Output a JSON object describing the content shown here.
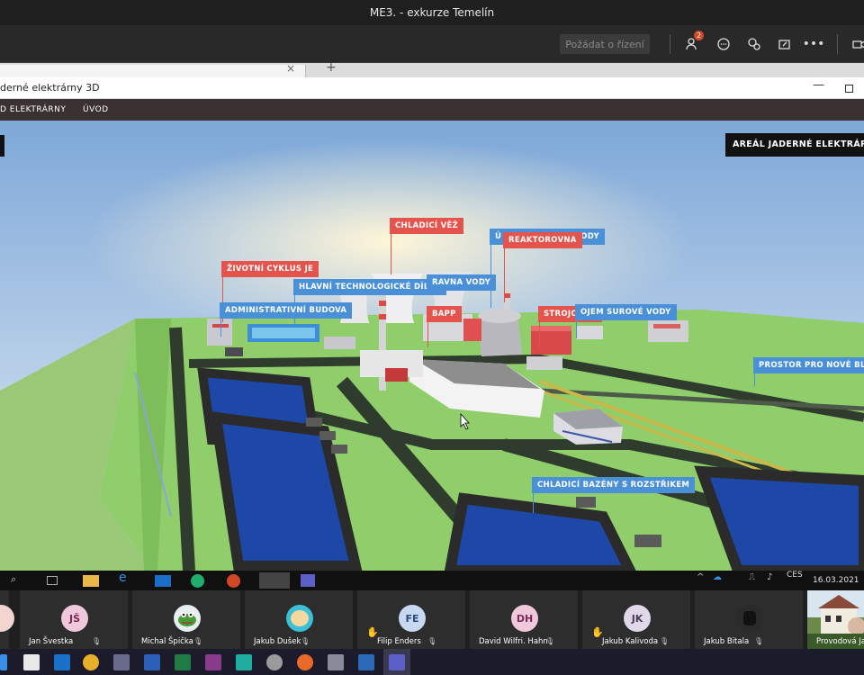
{
  "meeting": {
    "title": "ME3. - exkurze Temelín",
    "control_button": "Požádat o řízení",
    "participants_badge": "2"
  },
  "app": {
    "window_title": "derné elektrárny 3D",
    "nav": [
      "D ELEKTRÁRNY",
      "ÚVOD"
    ]
  },
  "scene": {
    "header_label": "AREÁL JADERNÉ ELEKTRÁRNY T",
    "labels": {
      "chladici_vez": "CHLADICÍ VĚŽ",
      "reaktorovna": "REAKTOROVNA",
      "upravna_vody_back": "VODY",
      "upravna_vody_prefix": "Ú",
      "zivotni_cyklus": "ŽIVOTNÍ CYKLUS JE",
      "hlavni_dilny": "HLAVNÍ TECHNOLOGICKÉ DÍLNY",
      "upravna_vody": "RAVNA VODY",
      "bapp": "BAPP",
      "strojovna": "STROJOVNA",
      "zasobnik_surove_vody": "OJEM SUROVÉ VODY",
      "administrativni_budova": "ADMINISTRATIVNÍ BUDOVA",
      "prostor_nove_bloky": "PROSTOR PRO NOVÉ BLOK",
      "chladici_bazeny": "CHLADICÍ BAZÉNY S ROZSTŘIKEM"
    }
  },
  "taskbar_inner": {
    "language": "CES",
    "date": "16.03.2021"
  },
  "participants": [
    {
      "initials": "",
      "name": "",
      "color": "#f3d5d0"
    },
    {
      "initials": "JŠ",
      "name": "Jan Švestka",
      "color": "#f0c8dc"
    },
    {
      "initials": "",
      "name": "Michal Špička",
      "color": "#e8eef0",
      "avatar": "frog-avatar"
    },
    {
      "initials": "",
      "name": "Jakub Dušek",
      "color": "#3cc0d8",
      "avatar": "face-avatar"
    },
    {
      "initials": "FE",
      "name": "Filip Enders",
      "color": "#c8d8f0",
      "hand": true
    },
    {
      "initials": "DH",
      "name": "David Wilfri. Hahn",
      "color": "#f0c8dc"
    },
    {
      "initials": "JK",
      "name": "Jakub Kalivoda",
      "color": "#e0d8e8",
      "hand": true
    },
    {
      "initials": "",
      "name": "Jakub Bitala",
      "color": "#222",
      "avatar": "dark-avatar"
    },
    {
      "initials": "",
      "name": "Provodová Jan",
      "color": "#5a7a3a",
      "avatar": "photo-avatar"
    }
  ]
}
